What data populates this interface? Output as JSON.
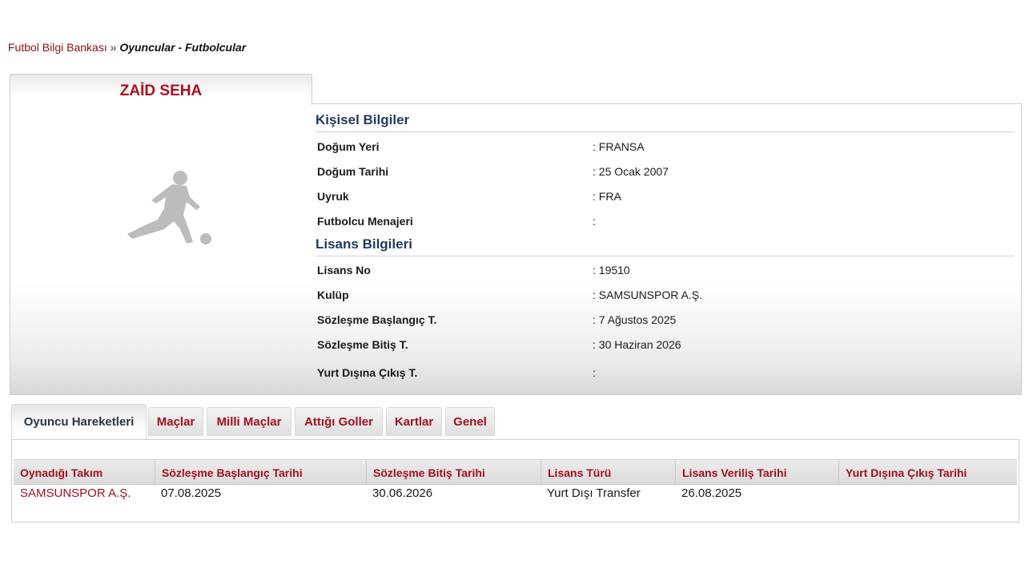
{
  "breadcrumb": {
    "root": "Futbol Bilgi Bankası",
    "separator": "»",
    "current": "Oyuncular - Futbolcular"
  },
  "player": {
    "name": "ZAİD SEHA"
  },
  "personal": {
    "title": "Kişisel Bilgiler",
    "rows": [
      {
        "label": "Doğum Yeri",
        "value": ":  FRANSA"
      },
      {
        "label": "Doğum Tarihi",
        "value": ":  25 Ocak 2007"
      },
      {
        "label": "Uyruk",
        "value": ":  FRA"
      },
      {
        "label": "Futbolcu Menajeri",
        "value": ":"
      }
    ]
  },
  "license": {
    "title": "Lisans Bilgileri",
    "rows": [
      {
        "label": "Lisans No",
        "value": ": 19510"
      },
      {
        "label": "Kulüp",
        "value": ": SAMSUNSPOR A.Ş."
      },
      {
        "label": "Sözleşme Başlangıç T.",
        "value": ": 7 Ağustos 2025"
      },
      {
        "label": "Sözleşme Bitiş T.",
        "value": ": 30 Haziran 2026"
      },
      {
        "label": "Yurt Dışına Çıkış T.",
        "value": ":"
      }
    ]
  },
  "tabs": [
    {
      "label": "Oyuncu Hareketleri",
      "active": true
    },
    {
      "label": "Maçlar",
      "active": false
    },
    {
      "label": "Milli Maçlar",
      "active": false
    },
    {
      "label": "Attığı Goller",
      "active": false
    },
    {
      "label": "Kartlar",
      "active": false
    },
    {
      "label": "Genel",
      "active": false
    }
  ],
  "movements": {
    "columns": [
      "Oynadığı Takım",
      "Sözleşme Başlangıç Tarihi",
      "Sözleşme Bitiş Tarihi",
      "Lisans Türü",
      "Lisans Veriliş Tarihi",
      "Yurt Dışına Çıkış Tarihi"
    ],
    "rows": [
      [
        "SAMSUNSPOR A.Ş.",
        "07.08.2025",
        "30.06.2026",
        "Yurt Dışı Transfer",
        "26.08.2025",
        ""
      ]
    ]
  },
  "colors": {
    "accent_red": "#a3101f",
    "section_blue": "#1e3a5f"
  },
  "icons": {
    "player_photo": "player-silhouette-icon"
  }
}
